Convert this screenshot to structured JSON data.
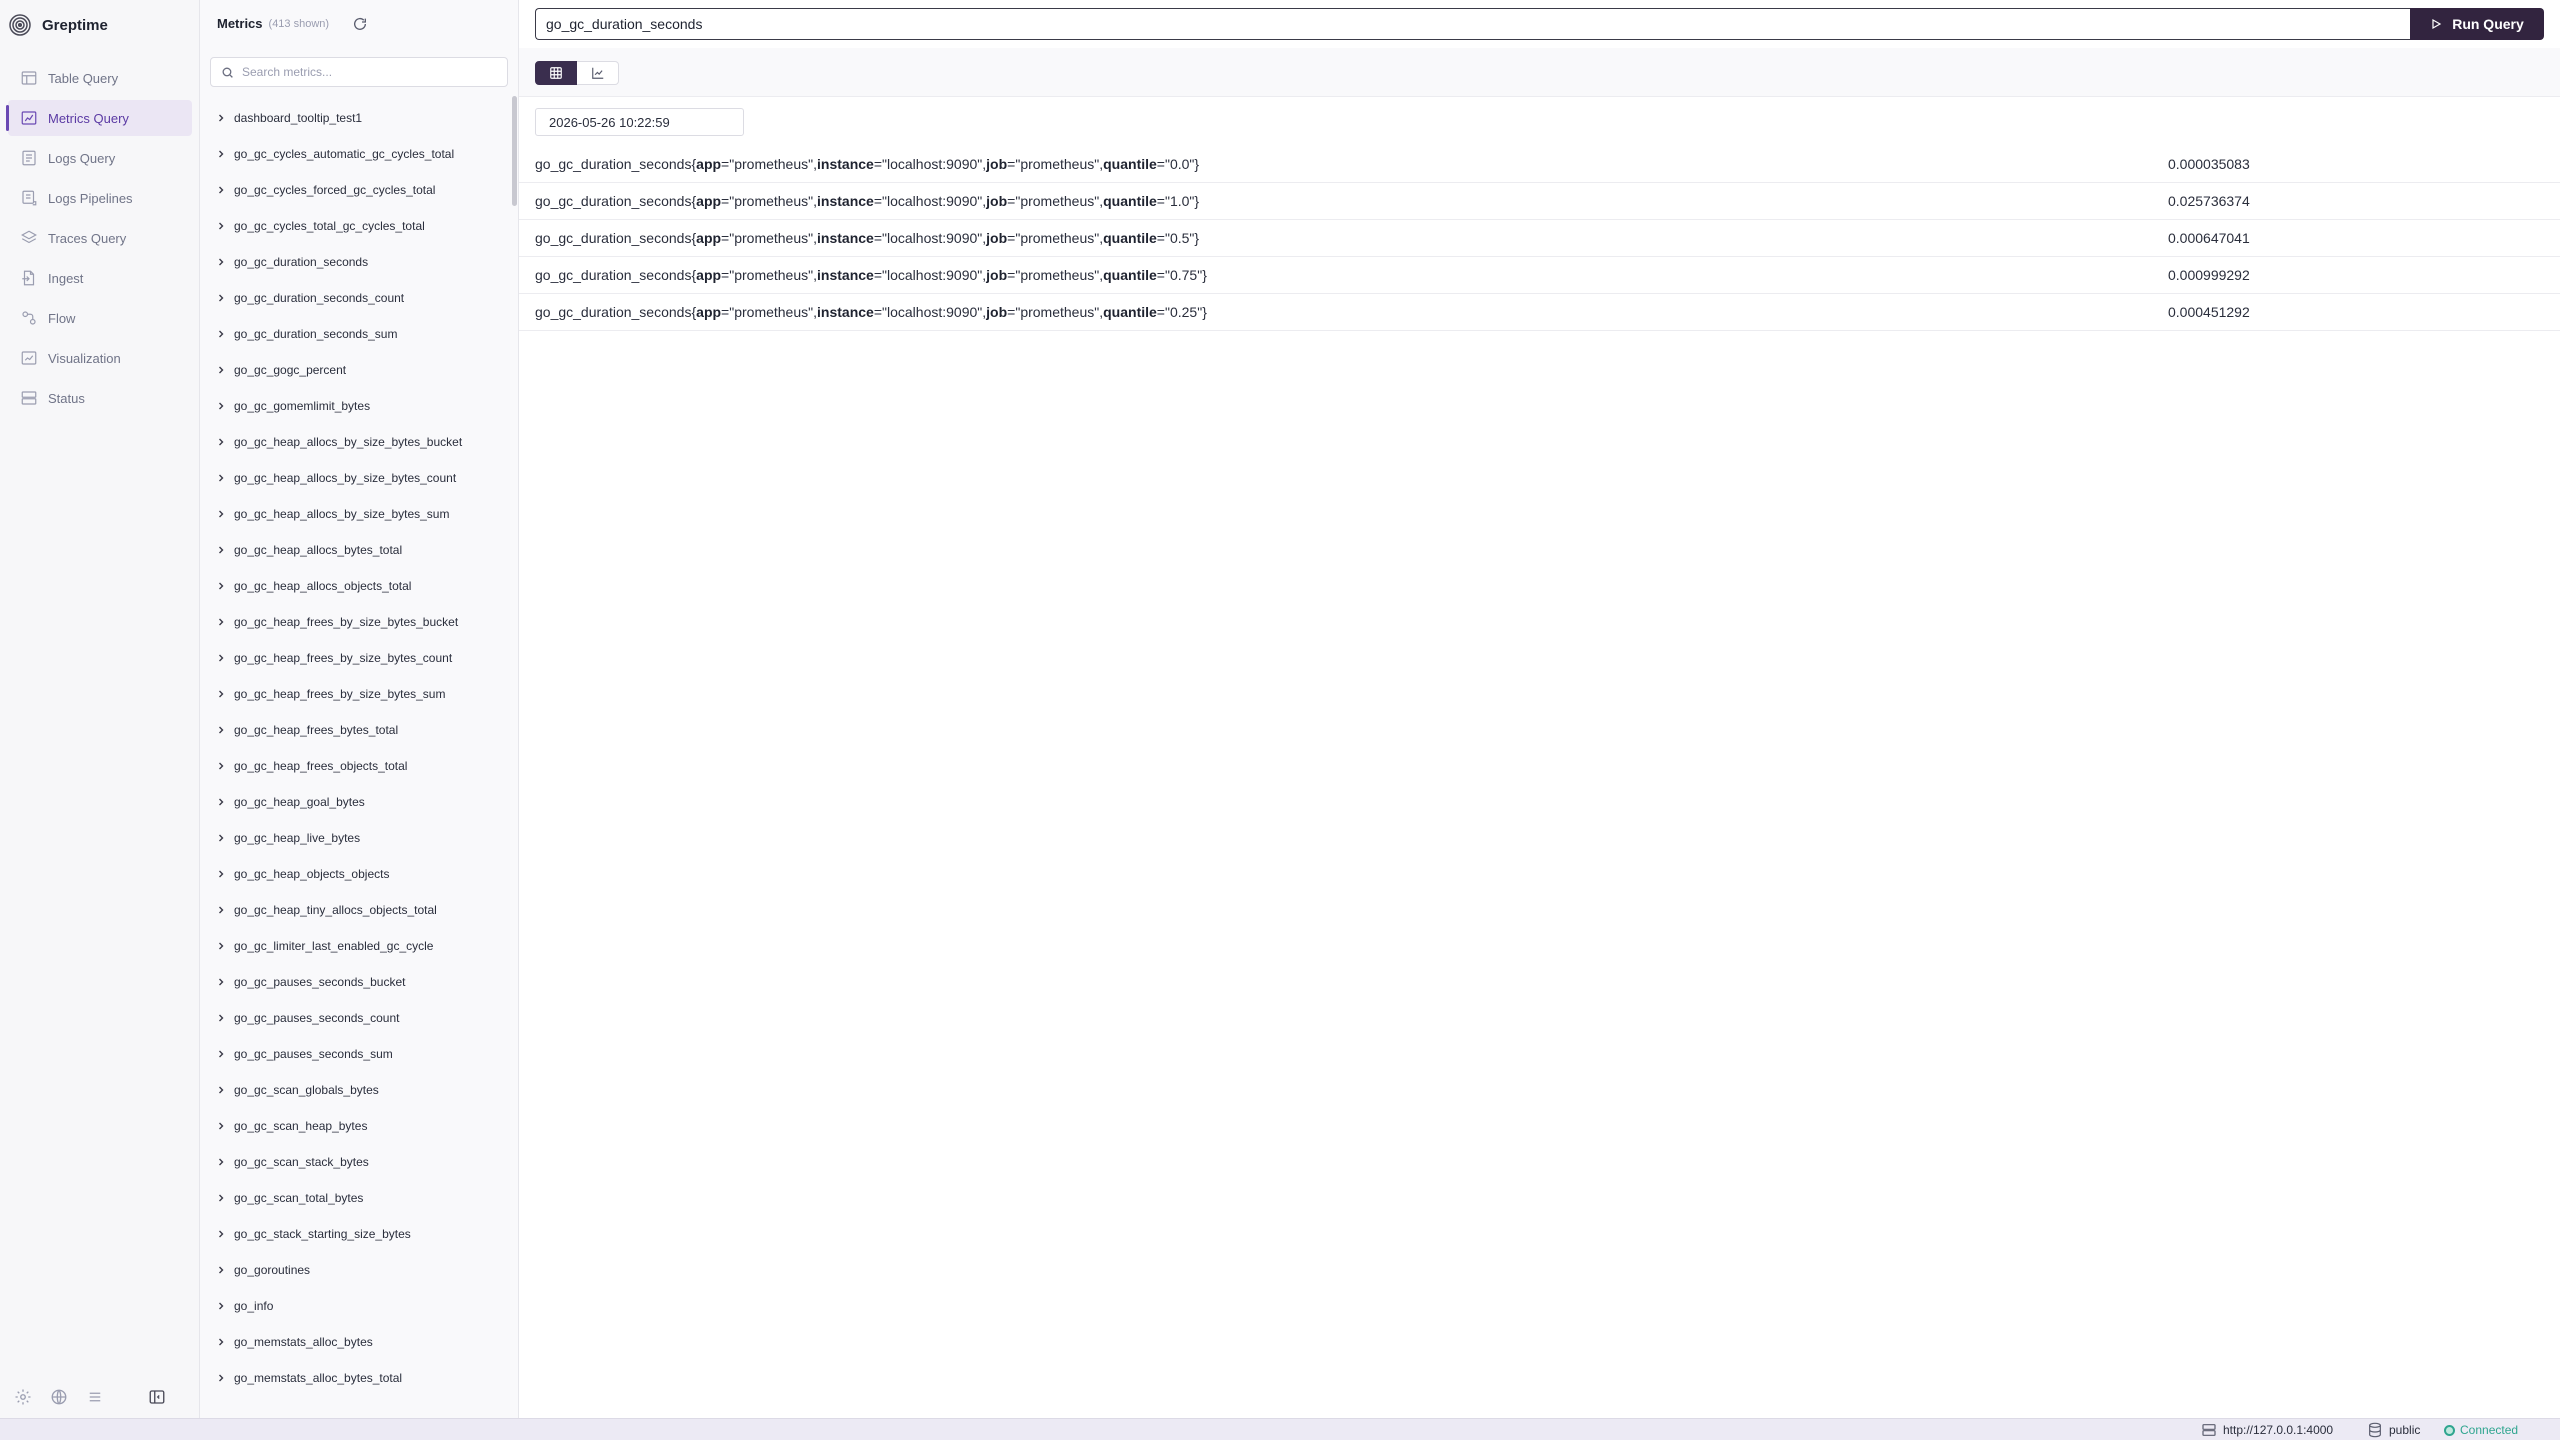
{
  "app": {
    "name": "Greptime"
  },
  "nav": {
    "items": [
      {
        "label": "Table Query",
        "icon": "table-icon",
        "active": false
      },
      {
        "label": "Metrics Query",
        "icon": "chart-icon",
        "active": true
      },
      {
        "label": "Logs Query",
        "icon": "document-icon",
        "active": false
      },
      {
        "label": "Logs Pipelines",
        "icon": "pipeline-icon",
        "active": false
      },
      {
        "label": "Traces Query",
        "icon": "layers-icon",
        "active": false
      },
      {
        "label": "Ingest",
        "icon": "file-import-icon",
        "active": false
      },
      {
        "label": "Flow",
        "icon": "flow-icon",
        "active": false
      },
      {
        "label": "Visualization",
        "icon": "dashboard-icon",
        "active": false
      },
      {
        "label": "Status",
        "icon": "server-icon",
        "active": false
      }
    ],
    "bottom_icons": [
      "settings-icon",
      "globe-icon",
      "menu-icon",
      "collapse-sidebar-icon"
    ]
  },
  "metrics_panel": {
    "title": "Metrics",
    "count": "(413 shown)",
    "search_placeholder": "Search metrics...",
    "items": [
      "dashboard_tooltip_test1",
      "go_gc_cycles_automatic_gc_cycles_total",
      "go_gc_cycles_forced_gc_cycles_total",
      "go_gc_cycles_total_gc_cycles_total",
      "go_gc_duration_seconds",
      "go_gc_duration_seconds_count",
      "go_gc_duration_seconds_sum",
      "go_gc_gogc_percent",
      "go_gc_gomemlimit_bytes",
      "go_gc_heap_allocs_by_size_bytes_bucket",
      "go_gc_heap_allocs_by_size_bytes_count",
      "go_gc_heap_allocs_by_size_bytes_sum",
      "go_gc_heap_allocs_bytes_total",
      "go_gc_heap_allocs_objects_total",
      "go_gc_heap_frees_by_size_bytes_bucket",
      "go_gc_heap_frees_by_size_bytes_count",
      "go_gc_heap_frees_by_size_bytes_sum",
      "go_gc_heap_frees_bytes_total",
      "go_gc_heap_frees_objects_total",
      "go_gc_heap_goal_bytes",
      "go_gc_heap_live_bytes",
      "go_gc_heap_objects_objects",
      "go_gc_heap_tiny_allocs_objects_total",
      "go_gc_limiter_last_enabled_gc_cycle",
      "go_gc_pauses_seconds_bucket",
      "go_gc_pauses_seconds_count",
      "go_gc_pauses_seconds_sum",
      "go_gc_scan_globals_bytes",
      "go_gc_scan_heap_bytes",
      "go_gc_scan_stack_bytes",
      "go_gc_scan_total_bytes",
      "go_gc_stack_starting_size_bytes",
      "go_goroutines",
      "go_info",
      "go_memstats_alloc_bytes",
      "go_memstats_alloc_bytes_total"
    ]
  },
  "query": {
    "value": "go_gc_duration_seconds",
    "run_label": "Run Query"
  },
  "view_toggle": [
    "table-view-icon",
    "graph-view-icon"
  ],
  "timestamp": "2026-05-26 10:22:59",
  "results": [
    {
      "metric": "go_gc_duration_seconds",
      "labels": [
        [
          "app",
          "prometheus"
        ],
        [
          "instance",
          "localhost:9090"
        ],
        [
          "job",
          "prometheus"
        ],
        [
          "quantile",
          "0.0"
        ]
      ],
      "value": "0.000035083"
    },
    {
      "metric": "go_gc_duration_seconds",
      "labels": [
        [
          "app",
          "prometheus"
        ],
        [
          "instance",
          "localhost:9090"
        ],
        [
          "job",
          "prometheus"
        ],
        [
          "quantile",
          "1.0"
        ]
      ],
      "value": "0.025736374"
    },
    {
      "metric": "go_gc_duration_seconds",
      "labels": [
        [
          "app",
          "prometheus"
        ],
        [
          "instance",
          "localhost:9090"
        ],
        [
          "job",
          "prometheus"
        ],
        [
          "quantile",
          "0.5"
        ]
      ],
      "value": "0.000647041"
    },
    {
      "metric": "go_gc_duration_seconds",
      "labels": [
        [
          "app",
          "prometheus"
        ],
        [
          "instance",
          "localhost:9090"
        ],
        [
          "job",
          "prometheus"
        ],
        [
          "quantile",
          "0.75"
        ]
      ],
      "value": "0.000999292"
    },
    {
      "metric": "go_gc_duration_seconds",
      "labels": [
        [
          "app",
          "prometheus"
        ],
        [
          "instance",
          "localhost:9090"
        ],
        [
          "job",
          "prometheus"
        ],
        [
          "quantile",
          "0.25"
        ]
      ],
      "value": "0.000451292"
    }
  ],
  "statusbar": {
    "host": "http://127.0.0.1:4000",
    "database": "public",
    "connection": "Connected"
  },
  "colors": {
    "accent": "#6a49b3",
    "run_button": "#32243f",
    "connected": "#2fa58f"
  }
}
